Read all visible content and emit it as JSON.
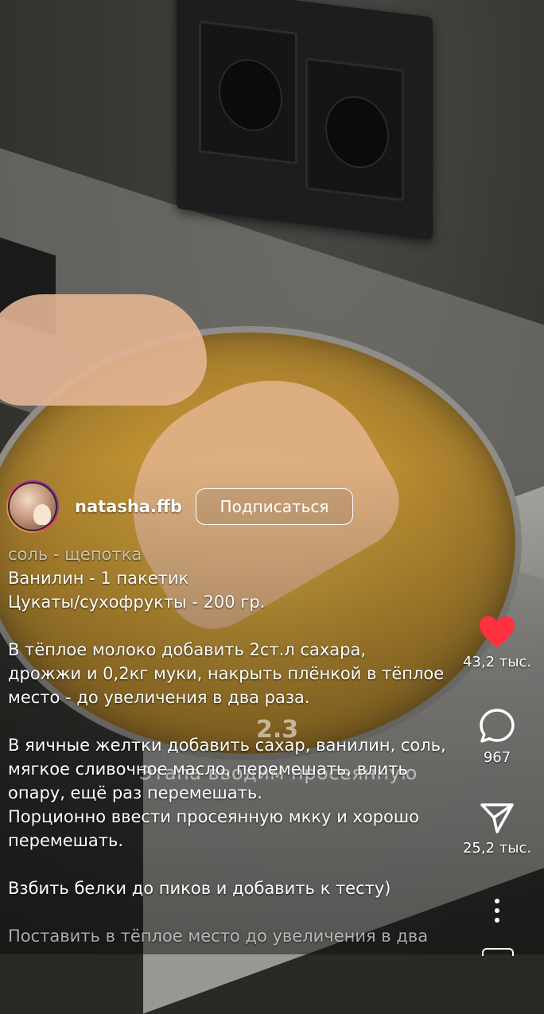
{
  "author": {
    "username": "natasha.ffb",
    "follow_label": "Подписаться"
  },
  "video": {
    "caption_number": "2.3",
    "caption_text": "Этапа вводим просеянную"
  },
  "description": {
    "lines": [
      "соль - щепотка",
      "Ванилин - 1 пакетик",
      "Цукаты/сухофрукты - 200 гр.",
      "",
      "В тёплое молоко добавить 2ст.л сахара,",
      "дрожжи и 0,2кг муки, накрыть плёнкой в тёплое",
      "место - до увеличения в два раза.",
      "",
      "В яичные желтки добавить сахар, ванилин, соль,",
      "мягкое сливочное масло, перемешать, влить",
      "опару, ещё раз перемешать.",
      "Порционно ввести просеянную мкку и хорошо",
      "перемешать.",
      "",
      "Взбить белки до пиков и добавить к тесту)",
      "",
      "Поставить в тёплое место до увеличения в два"
    ]
  },
  "actions": {
    "likes": "43,2 тыс.",
    "comments": "967",
    "shares": "25,2 тыс."
  },
  "colors": {
    "like": "#ff3040",
    "text": "#ffffff"
  },
  "icons": {
    "like": "heart-icon",
    "comment": "comment-bubble-icon",
    "share": "paper-plane-icon",
    "more": "more-dots-icon"
  }
}
